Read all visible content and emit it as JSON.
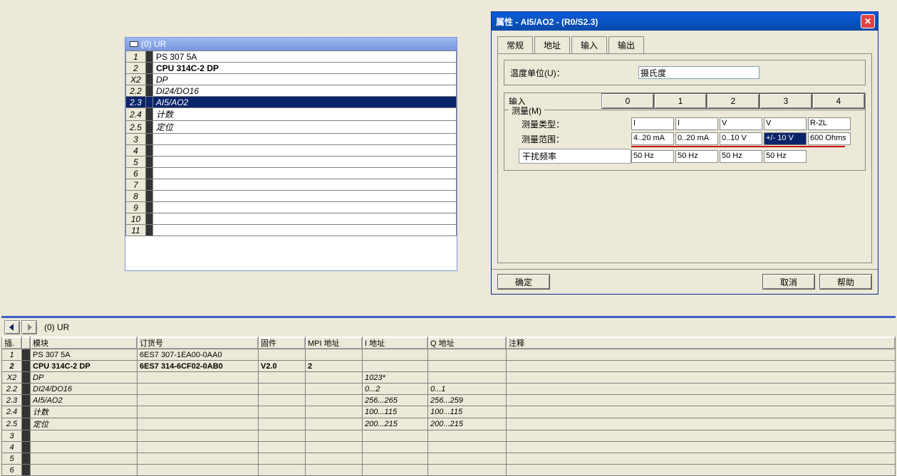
{
  "rack_window": {
    "title": "(0) UR",
    "rows": [
      {
        "slot": "1",
        "name": "PS 307 5A",
        "style": "normal"
      },
      {
        "slot": "2",
        "name": "CPU 314C-2 DP",
        "style": "bold"
      },
      {
        "slot": "X2",
        "name": "DP",
        "style": "italic"
      },
      {
        "slot": "2.2",
        "name": "DI24/DO16",
        "style": "italic"
      },
      {
        "slot": "2.3",
        "name": "AI5/AO2",
        "style": "italic",
        "selected": true
      },
      {
        "slot": "2.4",
        "name": "计数",
        "style": "italic"
      },
      {
        "slot": "2.5",
        "name": "定位",
        "style": "italic"
      },
      {
        "slot": "3",
        "name": "",
        "style": "normal"
      },
      {
        "slot": "4",
        "name": "",
        "style": "normal"
      },
      {
        "slot": "5",
        "name": "",
        "style": "normal"
      },
      {
        "slot": "6",
        "name": "",
        "style": "normal"
      },
      {
        "slot": "7",
        "name": "",
        "style": "normal"
      },
      {
        "slot": "8",
        "name": "",
        "style": "normal"
      },
      {
        "slot": "9",
        "name": "",
        "style": "normal"
      },
      {
        "slot": "10",
        "name": "",
        "style": "normal"
      },
      {
        "slot": "11",
        "name": "",
        "style": "normal"
      }
    ]
  },
  "prop_dialog": {
    "title": "属性 - AI5/AO2 - (R0/S2.3)",
    "tabs": [
      "常规",
      "地址",
      "输入",
      "输出"
    ],
    "active_tab": "输入",
    "temp_label": "温度单位(U)：",
    "temp_value": "摄氏度",
    "input_label": "输入",
    "input_cols": [
      "0",
      "1",
      "2",
      "3",
      "4"
    ],
    "group_label": "测量(M)",
    "meas_type_label": "测量类型：",
    "meas_type": [
      "I",
      "I",
      "V",
      "V",
      "R-2L"
    ],
    "meas_range_label": "测量范围：",
    "meas_range": [
      "4..20 mA",
      "0..20 mA",
      "0..10 V",
      "+/- 10 V",
      "600 Ohms"
    ],
    "meas_range_selected_idx": 3,
    "noise_label": "干扰频率",
    "noise": [
      "50 Hz",
      "50 Hz",
      "50 Hz",
      "50 Hz"
    ],
    "buttons": {
      "ok": "确定",
      "cancel": "取消",
      "help": "帮助"
    }
  },
  "bottom": {
    "nav_label": "(0)   UR",
    "columns": {
      "slot": "插.",
      "module": "模块",
      "order": "订货号",
      "fw": "固件",
      "mpi": "MPI 地址",
      "iaddr": "I 地址",
      "qaddr": "Q 地址",
      "comment": "注释"
    },
    "rows": [
      {
        "slot": "1",
        "module": "PS 307 5A",
        "order": "6ES7 307-1EA00-0AA0",
        "fw": "",
        "mpi": "",
        "iaddr": "",
        "qaddr": "",
        "style": "normal"
      },
      {
        "slot": "2",
        "module": "CPU 314C-2 DP",
        "order": "6ES7 314-6CF02-0AB0",
        "fw": "V2.0",
        "mpi": "2",
        "iaddr": "",
        "qaddr": "",
        "style": "bold"
      },
      {
        "slot": "X2",
        "module": "DP",
        "order": "",
        "fw": "",
        "mpi": "",
        "iaddr": "1023*",
        "qaddr": "",
        "style": "italic"
      },
      {
        "slot": "2.2",
        "module": "DI24/DO16",
        "order": "",
        "fw": "",
        "mpi": "",
        "iaddr": "0...2",
        "qaddr": "0...1",
        "style": "italic"
      },
      {
        "slot": "2.3",
        "module": "AI5/AO2",
        "order": "",
        "fw": "",
        "mpi": "",
        "iaddr": "256...265",
        "qaddr": "256...259",
        "style": "italic"
      },
      {
        "slot": "2.4",
        "module": "计数",
        "order": "",
        "fw": "",
        "mpi": "",
        "iaddr": "100...115",
        "qaddr": "100...115",
        "style": "italic"
      },
      {
        "slot": "2.5",
        "module": "定位",
        "order": "",
        "fw": "",
        "mpi": "",
        "iaddr": "200...215",
        "qaddr": "200...215",
        "style": "italic"
      },
      {
        "slot": "3",
        "module": "",
        "order": "",
        "fw": "",
        "mpi": "",
        "iaddr": "",
        "qaddr": "",
        "style": "normal"
      },
      {
        "slot": "4",
        "module": "",
        "order": "",
        "fw": "",
        "mpi": "",
        "iaddr": "",
        "qaddr": "",
        "style": "normal"
      },
      {
        "slot": "5",
        "module": "",
        "order": "",
        "fw": "",
        "mpi": "",
        "iaddr": "",
        "qaddr": "",
        "style": "normal"
      },
      {
        "slot": "6",
        "module": "",
        "order": "",
        "fw": "",
        "mpi": "",
        "iaddr": "",
        "qaddr": "",
        "style": "normal"
      }
    ]
  }
}
